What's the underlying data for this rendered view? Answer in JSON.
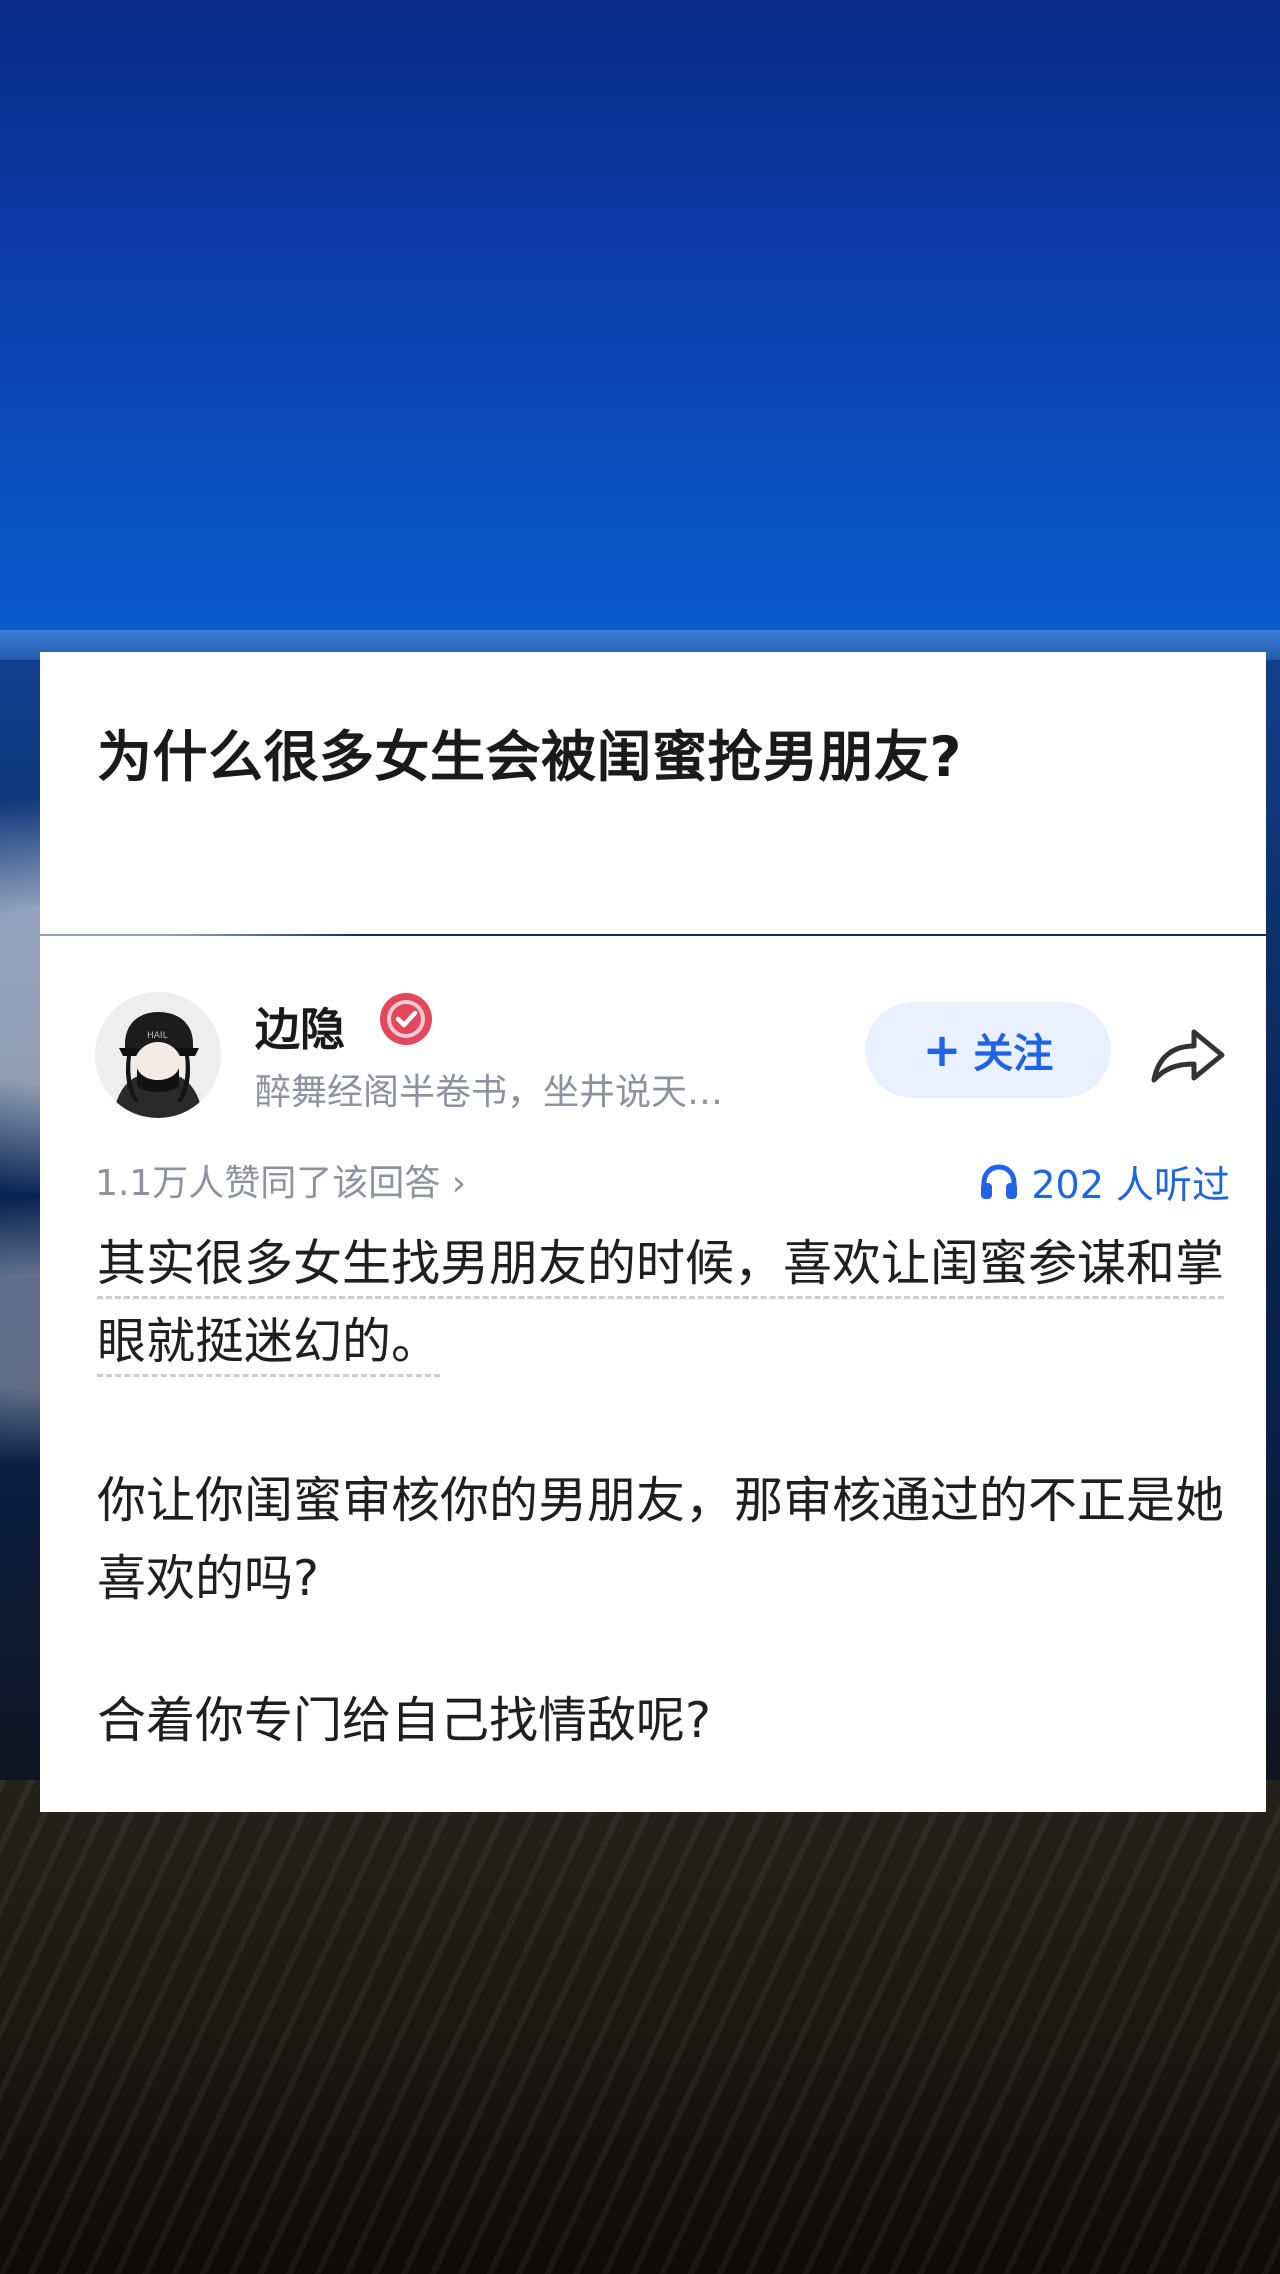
{
  "question": {
    "title": "为什么很多女生会被闺蜜抢男朋友?"
  },
  "author": {
    "name": "边隐",
    "bio": "醉舞经阁半卷书，坐井说天…",
    "follow_label": "关注",
    "follow_plus": "+"
  },
  "stats": {
    "approve_text": "1.1万人赞同了该回答 ›",
    "listen_text": "202 人听过"
  },
  "answer": {
    "paragraph1": "其实很多女生找男朋友的时候，喜欢让闺蜜参谋和掌眼就挺迷幻的。",
    "paragraph2": "你让你闺蜜审核你的男朋友，那审核通过的不正是她喜欢的吗?",
    "paragraph3": "合着你专门给自己找情敌呢?"
  },
  "colors": {
    "accent": "#1f63e6",
    "follow_bg": "#e9f0ff",
    "verified_badge": "#e2475c"
  },
  "icons": {
    "verified": "verified-badge-icon",
    "share": "share-arrow-icon",
    "listen": "headphones-icon"
  }
}
